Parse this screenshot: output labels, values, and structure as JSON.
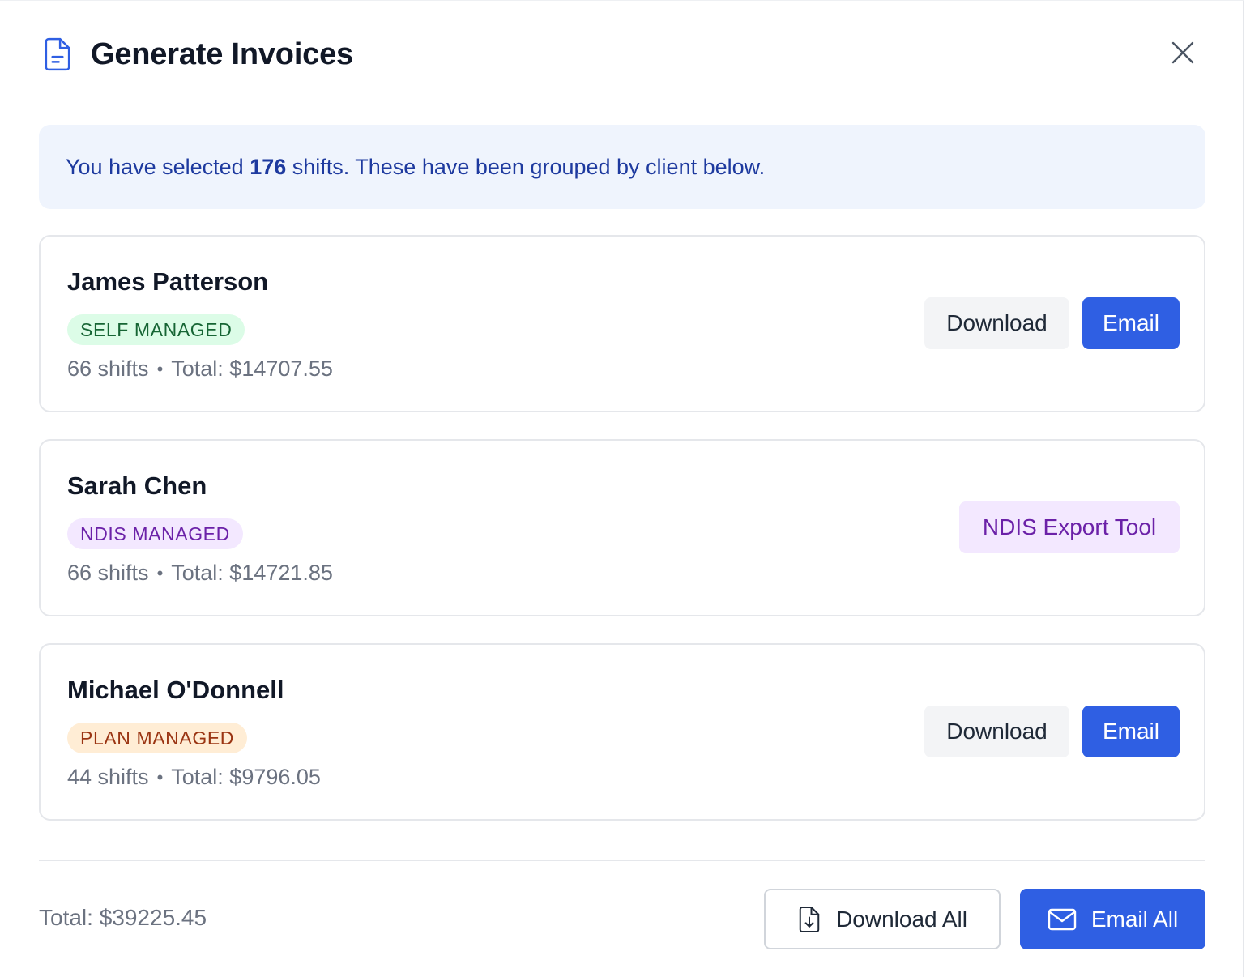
{
  "dialog": {
    "title": "Generate Invoices",
    "title_icon": "file-text-icon",
    "close_icon": "close-icon"
  },
  "info": {
    "prefix": "You have selected ",
    "count": "176",
    "suffix": " shifts. These have been grouped by client below."
  },
  "clients": [
    {
      "name": "James Patterson",
      "badge": "SELF MANAGED",
      "shifts": "66 shifts",
      "separator": "•",
      "total": "Total: $14707.55",
      "download_label": "Download",
      "email_label": "Email"
    },
    {
      "name": "Sarah Chen",
      "badge": "NDIS MANAGED",
      "shifts": "66 shifts",
      "separator": "•",
      "total": "Total: $14721.85",
      "ndis_label": "NDIS Export Tool"
    },
    {
      "name": "Michael O'Donnell",
      "badge": "PLAN MANAGED",
      "shifts": "44 shifts",
      "separator": "•",
      "total": "Total: $9796.05",
      "download_label": "Download",
      "email_label": "Email"
    }
  ],
  "footer": {
    "total": "Total: $39225.45",
    "download_all_label": "Download All",
    "download_all_icon": "file-download-icon",
    "email_all_label": "Email All",
    "email_all_icon": "mail-icon"
  },
  "colors": {
    "primary": "#2f5fe3",
    "info_bg": "#eff4fd",
    "info_text": "#1e3a9f",
    "self_badge_bg": "#dcfce7",
    "ndis_badge_bg": "#f3e8ff",
    "plan_badge_bg": "#ffedd5"
  }
}
